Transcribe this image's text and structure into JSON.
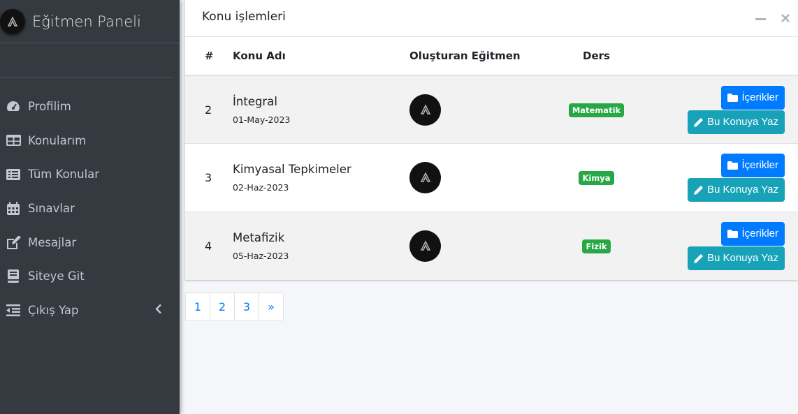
{
  "sidebar": {
    "brand": "Eğitmen Paneli",
    "items": [
      {
        "label": "Profilim",
        "icon": "tachometer-icon"
      },
      {
        "label": "Konularım",
        "icon": "table-icon"
      },
      {
        "label": "Tüm Konular",
        "icon": "list-icon"
      },
      {
        "label": "Sınavlar",
        "icon": "calendar-icon"
      },
      {
        "label": "Mesajlar",
        "icon": "edit-icon"
      },
      {
        "label": "Siteye Git",
        "icon": "book-icon"
      },
      {
        "label": "Çıkış Yap",
        "icon": "outdent-icon"
      }
    ]
  },
  "card": {
    "title": "Konu işlemleri",
    "columns": [
      "#",
      "Konu Adı",
      "Oluşturan Eğitmen",
      "Ders",
      ""
    ],
    "rows": [
      {
        "num": "2",
        "name": "İntegral",
        "date": "01-May-2023",
        "ders": "Matematik",
        "btn1": "İçerikler",
        "btn2": "Bu Konuya Yaz"
      },
      {
        "num": "3",
        "name": "Kimyasal Tepkimeler",
        "date": "02-Haz-2023",
        "ders": "Kimya",
        "btn1": "İçerikler",
        "btn2": "Bu Konuya Yaz"
      },
      {
        "num": "4",
        "name": "Metafizik",
        "date": "05-Haz-2023",
        "ders": "Fizik",
        "btn1": "İçerikler",
        "btn2": "Bu Konuya Yaz"
      }
    ]
  },
  "pagination": [
    "1",
    "2",
    "3",
    "»"
  ],
  "colors": {
    "sidebar_bg": "#343a40",
    "primary": "#007bff",
    "info": "#17a2b8",
    "badge": "#28a745"
  }
}
